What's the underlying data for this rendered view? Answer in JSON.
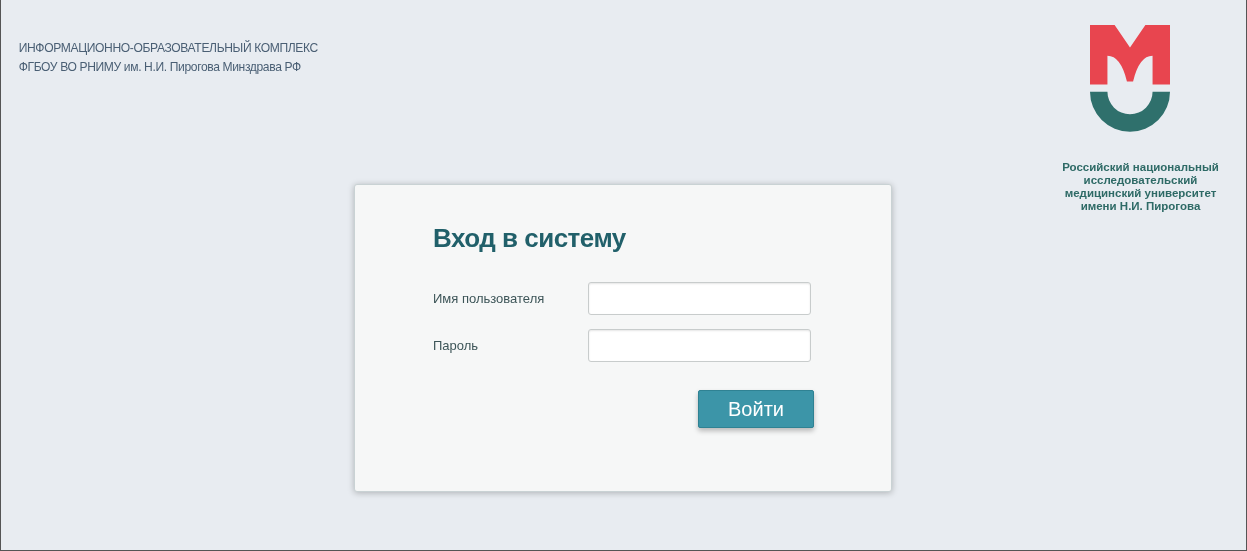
{
  "header": {
    "lines": [
      "ИНФОРМАЦИОННО-ОБРАЗОВАТЕЛЬНЫЙ КОМПЛЕКС",
      "ФГБОУ ВО РНИМУ им. Н.И. Пирогова Минздрава РФ"
    ]
  },
  "logo": {
    "caption": [
      "Российский национальный",
      "исследовательский",
      "медицинский университет",
      "имени Н.И. Пирогова"
    ]
  },
  "login": {
    "title": "Вход в систему",
    "fields": [
      {
        "label": "Имя пользователя"
      },
      {
        "label": "Пароль"
      }
    ],
    "button": "Войти"
  }
}
